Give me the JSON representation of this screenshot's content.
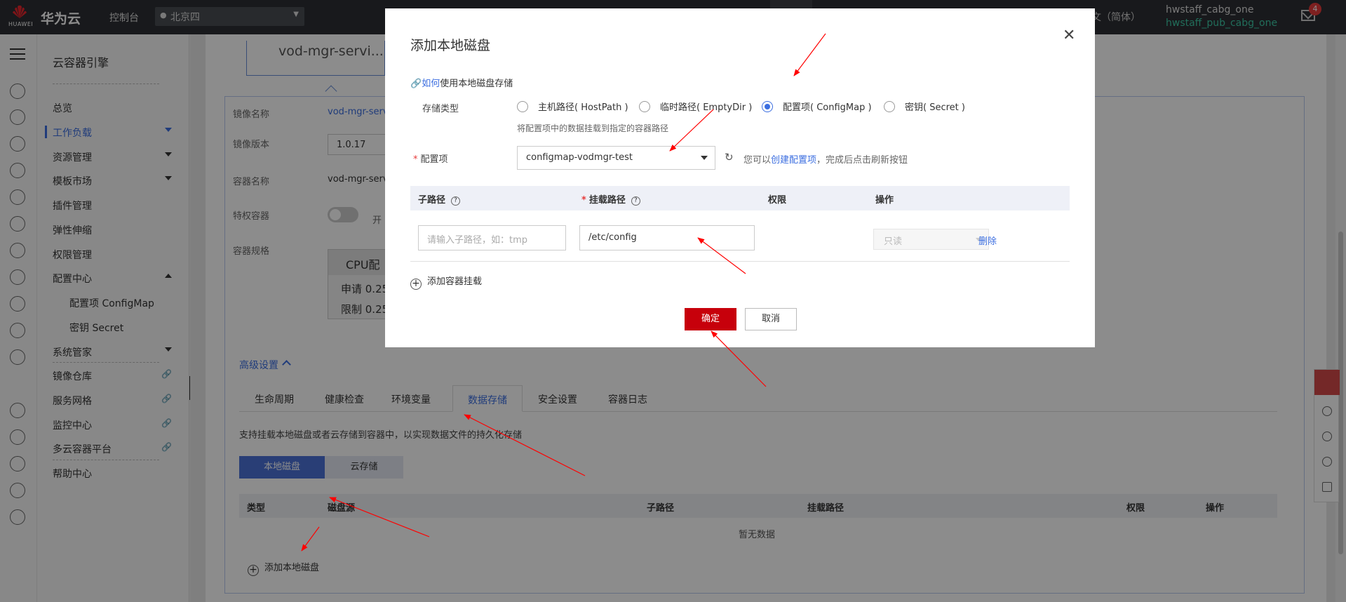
{
  "colors": {
    "accent": "#3b6ee0",
    "danger": "#c7000b",
    "topbar": "#2d2f33",
    "annotation": "#ff0000"
  },
  "topbar": {
    "logo_text": "HUAWEI",
    "brand": "华为云",
    "console": "控制台",
    "region": "北京四",
    "lang": "文（简体）",
    "user_name": "hwstaff_cabg_one",
    "user_sub": "hwstaff_pub_cabg_one",
    "mail_badge": "4"
  },
  "sidebar": {
    "title": "云容器引擎",
    "items": [
      {
        "label": "总览"
      },
      {
        "label": "工作负载"
      },
      {
        "label": "资源管理"
      },
      {
        "label": "模板市场"
      },
      {
        "label": "插件管理"
      },
      {
        "label": "弹性伸缩"
      },
      {
        "label": "权限管理"
      },
      {
        "label": "配置中心"
      },
      {
        "label": "配置项 ConfigMap"
      },
      {
        "label": "密钥 Secret"
      },
      {
        "label": "系统管家"
      },
      {
        "label": "镜像仓库"
      },
      {
        "label": "服务网格"
      },
      {
        "label": "监控中心"
      },
      {
        "label": "多云容器平台"
      },
      {
        "label": "帮助中心"
      }
    ]
  },
  "main": {
    "card_name": "vod-mgr-servi...",
    "fields": {
      "image_name_label": "镜像名称",
      "image_name_value": "vod-mgr-serv",
      "image_version_label": "镜像版本",
      "image_version_value": "1.0.17",
      "container_name_label": "容器名称",
      "container_name_value": "vod-mgr-serv",
      "privileged_label": "特权容器",
      "privileged_text": "开",
      "spec_label": "容器规格",
      "spec_head": "CPU配",
      "spec_request": "申请 0.25",
      "spec_limit": "限制 0.25"
    },
    "advanced": "高级设置",
    "tabs": [
      "生命周期",
      "健康检查",
      "环境变量",
      "数据存储",
      "安全设置",
      "容器日志"
    ],
    "storage_desc": "支持挂载本地磁盘或者云存储到容器中，以实现数据文件的持久化存储",
    "btn_local": "本地磁盘",
    "btn_cloud": "云存储",
    "table_headers": [
      "类型",
      "磁盘源",
      "子路径",
      "挂载路径",
      "权限",
      "操作"
    ],
    "empty": "暂无数据",
    "add_local": "添加本地磁盘"
  },
  "dialog": {
    "title": "添加本地磁盘",
    "howto_link": "如何",
    "howto_text": "使用本地磁盘存储",
    "storage_type_label": "存储类型",
    "radio_options": [
      "主机路径( HostPath )",
      "临时路径( EmptyDir )",
      "配置项( ConfigMap )",
      "密钥( Secret )"
    ],
    "selected_radio": "配置项( ConfigMap )",
    "radio_hint": "将配置项中的数据挂载到指定的容器路径",
    "config_label": "配置项",
    "config_value": "configmap-vodmgr-test",
    "refresh_hint_pre": "您可以",
    "refresh_hint_link": "创建配置项",
    "refresh_hint_post": "，完成后点击刷新按钮",
    "table_headers": {
      "subpath": "子路径",
      "mount": "挂载路径",
      "perm": "权限",
      "op": "操作"
    },
    "subpath_placeholder": "请输入子路径，如：tmp",
    "mount_value": "/etc/config",
    "perm_value": "只读",
    "delete": "删除",
    "add_mount": "添加容器挂载",
    "ok": "确定",
    "cancel": "取消"
  }
}
